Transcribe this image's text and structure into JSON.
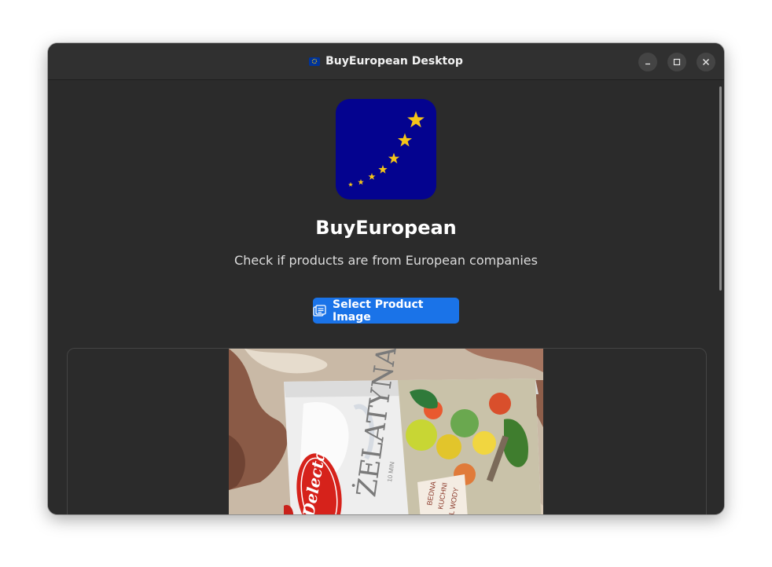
{
  "window": {
    "title": "BuyEuropean Desktop",
    "controls": {
      "minimize": "minimize-icon",
      "maximize": "maximize-icon",
      "close": "close-icon"
    }
  },
  "app": {
    "name": "BuyEuropean",
    "tagline": "Check if products are from European companies",
    "logo_icon": "eu-stars-logo",
    "colors": {
      "logo_background": "#04038f",
      "stars": "#f5c518",
      "accent_button": "#1a73e8",
      "window_background": "#2b2b2b"
    }
  },
  "actions": {
    "select_image_label": "Select Product Image",
    "select_image_icon": "image-files-icon"
  },
  "preview": {
    "photo_icon": "product-photo",
    "product_text": "ŻELATYNA",
    "brand_text": "Delecta"
  }
}
